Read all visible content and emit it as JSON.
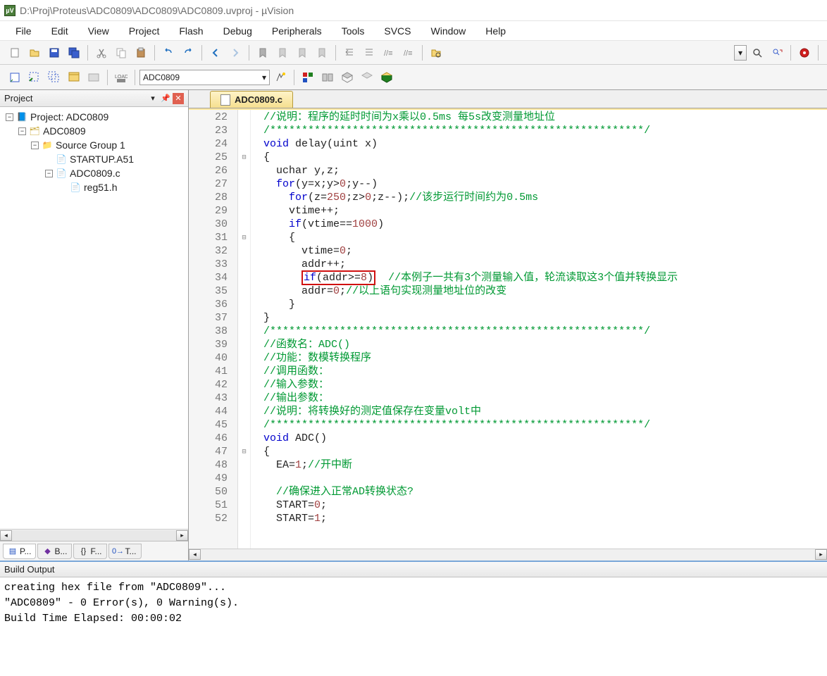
{
  "title_bar": {
    "icon_text": "µV",
    "path": "D:\\Proj\\Proteus\\ADC0809\\ADC0809\\ADC0809.uvproj - µVision"
  },
  "menu": [
    "File",
    "Edit",
    "View",
    "Project",
    "Flash",
    "Debug",
    "Peripherals",
    "Tools",
    "SVCS",
    "Window",
    "Help"
  ],
  "toolbar2": {
    "target_name": "ADC0809"
  },
  "project_panel": {
    "title": "Project",
    "root": "Project: ADC0809",
    "target": "ADC0809",
    "group": "Source Group 1",
    "files": [
      "STARTUP.A51",
      "ADC0809.c"
    ],
    "sub_file": "reg51.h",
    "tabs": [
      "P...",
      "B...",
      "F...",
      "T..."
    ]
  },
  "editor": {
    "tab_name": "ADC0809.c",
    "first_line": 22,
    "lines": [
      {
        "n": 22,
        "html": "  <span class='cm'>//说明：程序的延时时间为x乘以0.5ms 每5s改变测量地址位</span>"
      },
      {
        "n": 23,
        "html": "  <span class='cm'>/***********************************************************/</span>"
      },
      {
        "n": 24,
        "html": "  <span class='kw'>void</span> delay(uint x)"
      },
      {
        "n": 25,
        "fold": "⊟",
        "html": "  {"
      },
      {
        "n": 26,
        "html": "    uchar y,z;"
      },
      {
        "n": 27,
        "html": "    <span class='kw'>for</span>(y=x;y&gt;<span class='num'>0</span>;y--)"
      },
      {
        "n": 28,
        "html": "      <span class='kw'>for</span>(z=<span class='num'>250</span>;z&gt;<span class='num'>0</span>;z--);<span class='cm'>//该步运行时间约为0.5ms</span>"
      },
      {
        "n": 29,
        "html": "      vtime++;"
      },
      {
        "n": 30,
        "html": "      <span class='kw'>if</span>(vtime==<span class='num'>1000</span>)"
      },
      {
        "n": 31,
        "fold": "⊟",
        "html": "      {"
      },
      {
        "n": 32,
        "html": "        vtime=<span class='num'>0</span>;"
      },
      {
        "n": 33,
        "html": "        addr++;"
      },
      {
        "n": 34,
        "html": "        <span class='hl'><span class='kw'>if</span>(addr&gt;=<span class='num'>8</span>)</span>  <span class='cm'>//本例子一共有3个测量输入值，轮流读取这3个值并转换显示</span>"
      },
      {
        "n": 35,
        "html": "        addr=<span class='num'>0</span>;<span class='cm'>//以上语句实现测量地址位的改变</span>"
      },
      {
        "n": 36,
        "html": "      }"
      },
      {
        "n": 37,
        "html": "  }"
      },
      {
        "n": 38,
        "html": "  <span class='cm'>/***********************************************************/</span>"
      },
      {
        "n": 39,
        "html": "  <span class='cm'>//函数名：ADC()</span>"
      },
      {
        "n": 40,
        "html": "  <span class='cm'>//功能：数模转换程序</span>"
      },
      {
        "n": 41,
        "html": "  <span class='cm'>//调用函数：</span>"
      },
      {
        "n": 42,
        "html": "  <span class='cm'>//输入参数：</span>"
      },
      {
        "n": 43,
        "html": "  <span class='cm'>//输出参数：</span>"
      },
      {
        "n": 44,
        "html": "  <span class='cm'>//说明：将转换好的测定值保存在变量volt中</span>"
      },
      {
        "n": 45,
        "html": "  <span class='cm'>/***********************************************************/</span>"
      },
      {
        "n": 46,
        "html": "  <span class='kw'>void</span> ADC()"
      },
      {
        "n": 47,
        "fold": "⊟",
        "html": "  {"
      },
      {
        "n": 48,
        "html": "    EA=<span class='num'>1</span>;<span class='cm'>//开中断</span>"
      },
      {
        "n": 49,
        "html": ""
      },
      {
        "n": 50,
        "html": "    <span class='cm'>//确保进入正常AD转换状态?</span>"
      },
      {
        "n": 51,
        "html": "    START=<span class='num'>0</span>;"
      },
      {
        "n": 52,
        "html": "    START=<span class='num'>1</span>;"
      }
    ]
  },
  "output": {
    "title": "Build Output",
    "lines": [
      "creating hex file from \"ADC0809\"...",
      "\"ADC0809\" - 0 Error(s), 0 Warning(s).",
      "Build Time Elapsed:  00:00:02"
    ]
  }
}
